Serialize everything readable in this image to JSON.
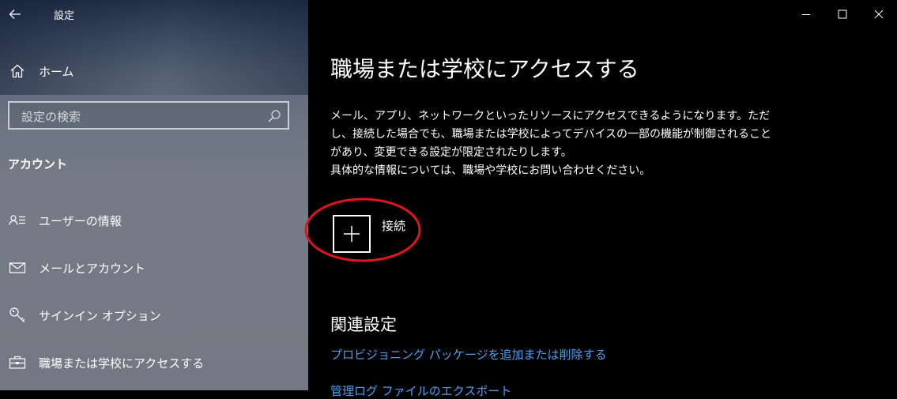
{
  "window": {
    "app_title": "設定",
    "back_icon": "back-arrow-icon",
    "minimize_icon": "minimize-icon",
    "maximize_icon": "maximize-icon",
    "close_icon": "close-icon"
  },
  "sidebar": {
    "home": {
      "label": "ホーム",
      "icon": "home-icon"
    },
    "search": {
      "placeholder": "設定の検索",
      "icon": "search-icon"
    },
    "section_title": "アカウント",
    "items": [
      {
        "label": "ユーザーの情報",
        "icon": "user-info-icon"
      },
      {
        "label": "メールとアカウント",
        "icon": "mail-icon"
      },
      {
        "label": "サインイン オプション",
        "icon": "key-icon"
      },
      {
        "label": "職場または学校にアクセスする",
        "icon": "briefcase-icon"
      }
    ]
  },
  "main": {
    "title": "職場または学校にアクセスする",
    "description_lines": [
      "メール、アプリ、ネットワークといったリソースにアクセスできるようになります。ただし、接続した場合でも、職場または学校によってデバイスの一部の機能が制御されることがあり、変更できる設定が限定されたりします。",
      "具体的な情報については、職場や学校にお問い合わせください。"
    ],
    "connect": {
      "label": "接続",
      "icon": "plus-icon"
    },
    "highlight_color": "#e0141e",
    "related": {
      "title": "関連設定",
      "links": [
        "プロビジョニング パッケージを追加または削除する",
        "管理ログ ファイルのエクスポート"
      ]
    }
  },
  "colors": {
    "accent_link": "#4aa0ee",
    "background": "#000000"
  }
}
